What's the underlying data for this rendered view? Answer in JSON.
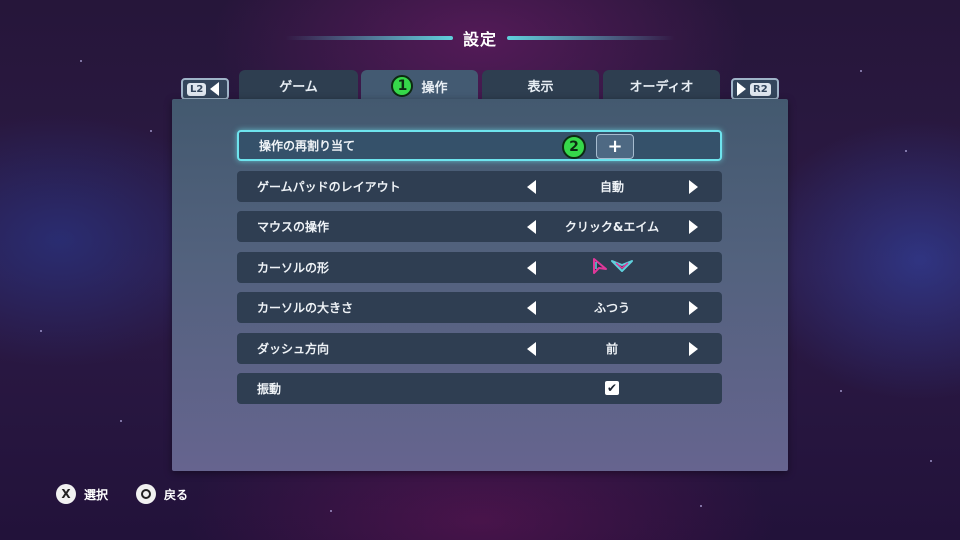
{
  "header": {
    "title": "設定"
  },
  "bumpers": {
    "left_label": "L2",
    "right_label": "R2"
  },
  "tabs": [
    {
      "label": "ゲーム"
    },
    {
      "label": "操作",
      "badge": "1"
    },
    {
      "label": "表示"
    },
    {
      "label": "オーディオ"
    }
  ],
  "rows": [
    {
      "label": "操作の再割り当て",
      "badge": "2",
      "button": "+"
    },
    {
      "label": "ゲームパッドのレイアウト",
      "value": "自動"
    },
    {
      "label": "マウスの操作",
      "value": "クリック&エイム"
    },
    {
      "label": "カーソルの形"
    },
    {
      "label": "カーソルの大きさ",
      "value": "ふつう"
    },
    {
      "label": "ダッシュ方向",
      "value": "前"
    },
    {
      "label": "振動",
      "checked": true
    }
  ],
  "footer": {
    "select": {
      "icon": "x-button-icon",
      "glyph": "X",
      "label": "選択"
    },
    "back": {
      "icon": "circle-button-icon",
      "label": "戻る"
    }
  },
  "colors": {
    "accent": "#6ee4ee",
    "badge": "#36d84a",
    "cursor_pink": "#e0389a",
    "cursor_cyan": "#5fd0dc"
  }
}
